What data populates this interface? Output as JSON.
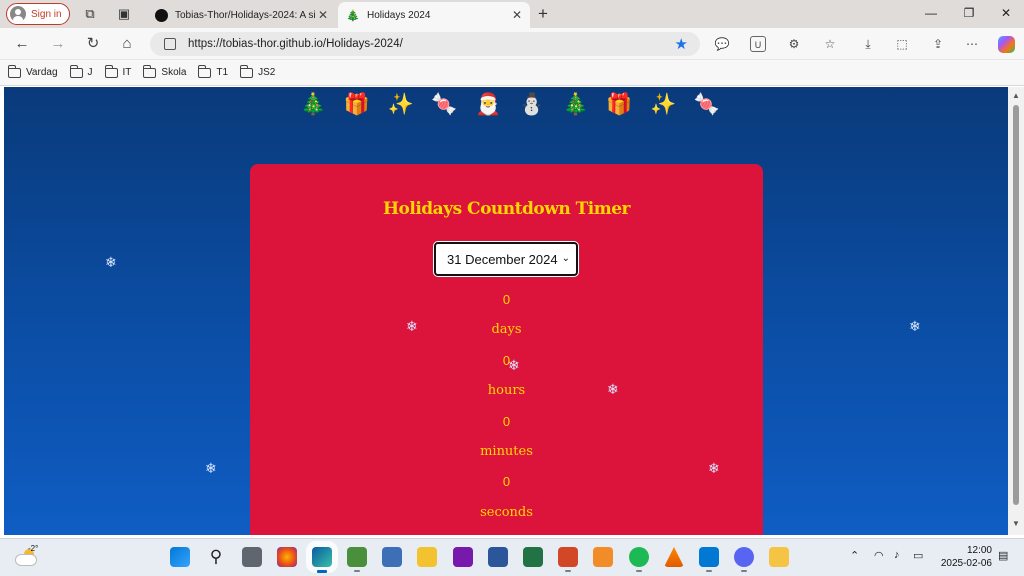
{
  "browser": {
    "sign_in_label": "Sign in",
    "tabs": [
      {
        "title": "Tobias-Thor/Holidays-2024: A sim",
        "favicon": "github-icon",
        "active": false
      },
      {
        "title": "Holidays 2024",
        "favicon": "christmas-tree-icon",
        "active": true
      }
    ],
    "url": "https://tobias-thor.github.io/Holidays-2024/",
    "bookmarks": [
      "Vardag",
      "J",
      "IT",
      "Skola",
      "T1",
      "JS2"
    ]
  },
  "page": {
    "emojis": [
      "🎄",
      "🎁",
      "✨",
      "🍬",
      "🎅",
      "⛄",
      "🎄",
      "🎁",
      "✨",
      "🍬"
    ],
    "title": "Holidays Countdown Timer",
    "select": {
      "selected": "31 December 2024"
    },
    "countdown": {
      "days_value": "0",
      "days_label": "days",
      "hours_value": "0",
      "hours_label": "hours",
      "minutes_value": "0",
      "minutes_label": "minutes",
      "seconds_value": "0",
      "seconds_label": "seconds"
    },
    "snowflake": "❄",
    "colors": {
      "background": "#0b4ea6",
      "card": "#dc143c",
      "accent": "#ffd700"
    }
  },
  "taskbar": {
    "weather_temp": "-2°",
    "time": "12:00",
    "date": "2025-02-06"
  }
}
